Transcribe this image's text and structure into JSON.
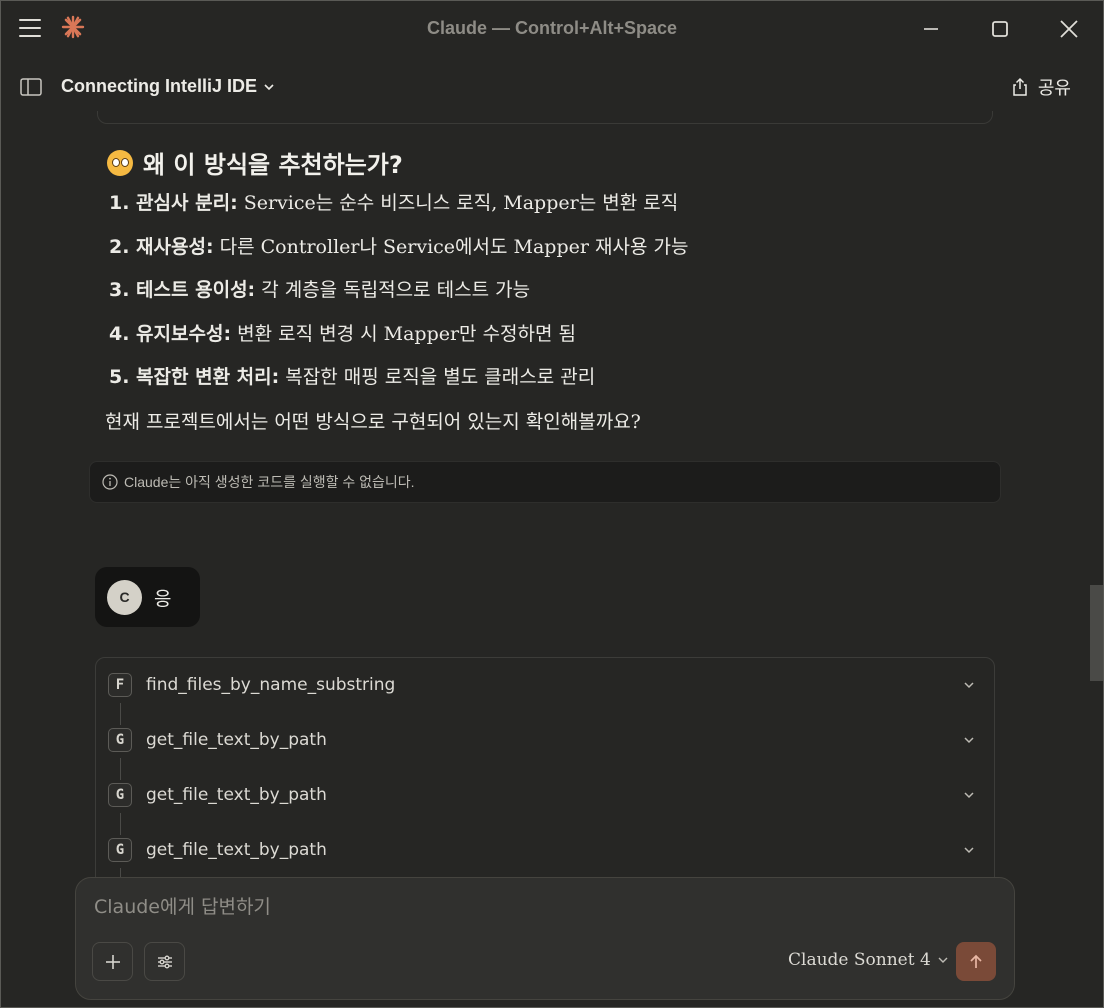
{
  "window": {
    "title": "Claude — Control+Alt+Space"
  },
  "header": {
    "conversation_title": "Connecting IntelliJ IDE",
    "share_label": "공유"
  },
  "message": {
    "heading": "왜 이 방식을 추천하는가?",
    "reasons": [
      {
        "title": "1. 관심사 분리:",
        "text": " Service는 순수 비즈니스 로직, Mapper는 변환 로직"
      },
      {
        "title": "2. 재사용성:",
        "text": " 다른 Controller나 Service에서도 Mapper 재사용 가능"
      },
      {
        "title": "3. 테스트 용이성:",
        "text": " 각 계층을 독립적으로 테스트 가능"
      },
      {
        "title": "4. 유지보수성:",
        "text": " 변환 로직 변경 시 Mapper만 수정하면 됨"
      },
      {
        "title": "5. 복잡한 변환 처리:",
        "text": " 복잡한 매핑 로직을 별도 클래스로 관리"
      }
    ],
    "closing": "현재 프로젝트에서는 어떤 방식으로 구현되어 있는지 확인해볼까요?",
    "disclaimer": "Claude는 아직 생성한 코드를 실행할 수 없습니다."
  },
  "user_message": {
    "avatar_initial": "C",
    "text": "응"
  },
  "tool_calls": [
    {
      "badge": "F",
      "name": "find_files_by_name_substring"
    },
    {
      "badge": "G",
      "name": "get_file_text_by_path"
    },
    {
      "badge": "G",
      "name": "get_file_text_by_path"
    },
    {
      "badge": "G",
      "name": "get_file_text_by_path"
    }
  ],
  "composer": {
    "placeholder": "Claude에게 답변하기",
    "model": "Claude Sonnet 4"
  },
  "colors": {
    "background": "#262624",
    "accent": "#d97757",
    "send_button": "#7a4a38"
  }
}
